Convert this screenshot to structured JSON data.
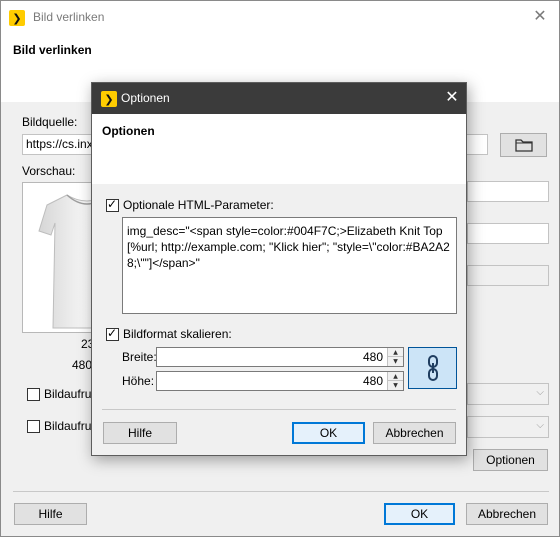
{
  "outer": {
    "title": "Bild verlinken",
    "header_title": "Bild verlinken",
    "bildquelle_label": "Bildquelle:",
    "bildquelle_value": "https://cs.inxs",
    "vorschau_label": "Vorschau:",
    "preview_caption_1": "23",
    "preview_caption_2": "480x",
    "bildaufruf_1_label": "Bildaufruf",
    "bildaufruf_2_label": "Bildaufruf",
    "optionen_button": "Optionen",
    "hilfe_button": "Hilfe",
    "ok_button": "OK",
    "abbrechen_button": "Abbrechen",
    "close_glyph": "✕",
    "folder_icon": "folder-icon"
  },
  "modal": {
    "title": "Optionen",
    "header_title": "Optionen",
    "html_params_label": "Optionale HTML-Parameter:",
    "html_params_checked": true,
    "html_params_value": "img_desc=\"<span style=color:#004F7C;>Elizabeth Knit Top [%url; http://example.com; \"Klick hier\"; \"style=\\\"color:#BA2A28;\\\"\"]</span>\"",
    "scale_label": "Bildformat skalieren:",
    "scale_checked": true,
    "breite_label": "Breite:",
    "breite_value": "480",
    "hoehe_label": "Höhe:",
    "hoehe_value": "480",
    "link_icon": "chain-link-icon",
    "hilfe_button": "Hilfe",
    "ok_button": "OK",
    "abbrechen_button": "Abbrechen",
    "close_glyph": "✕"
  },
  "colors": {
    "modal_titlebar": "#3b3b3b",
    "accent": "#0078d7",
    "app_icon": "#ffcc00"
  }
}
